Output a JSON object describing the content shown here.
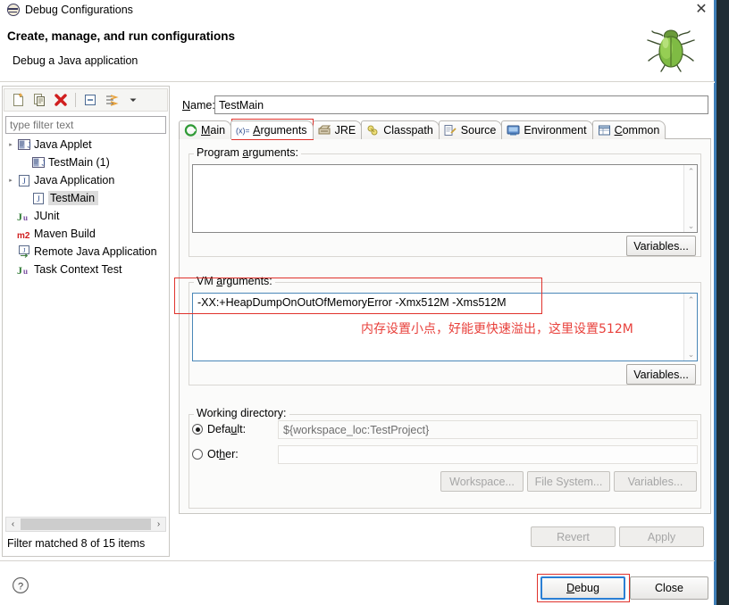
{
  "window": {
    "title": "Debug Configurations",
    "title_icon": "debug-config-icon",
    "close_label": "✕",
    "header_title": "Create, manage, and run configurations",
    "header_subtitle": "Debug a Java application",
    "decoration_icon": "green-bug-icon"
  },
  "sidebar": {
    "toolbar": [
      {
        "name": "new-configuration",
        "icon": "new-document-icon"
      },
      {
        "name": "duplicate-configuration",
        "icon": "copy-icon"
      },
      {
        "name": "delete-configuration",
        "icon": "red-x-delete-icon"
      },
      {
        "name": "collapse-all",
        "icon": "collapse-all-icon"
      },
      {
        "name": "filter-configurations",
        "icon": "filter-sort-icon"
      },
      {
        "name": "view-menu",
        "icon": "chevron-down-icon"
      }
    ],
    "filter": {
      "placeholder": "type filter text",
      "value": ""
    },
    "tree": [
      {
        "label": "Java Applet",
        "icon": "java-applet-icon",
        "indent": 0,
        "expandable": true,
        "selected": false
      },
      {
        "label": "TestMain (1)",
        "icon": "java-applet-icon",
        "indent": 1,
        "expandable": false,
        "selected": false
      },
      {
        "label": "Java Application",
        "icon": "java-application-icon",
        "indent": 0,
        "expandable": true,
        "selected": false
      },
      {
        "label": "TestMain",
        "icon": "java-application-icon",
        "indent": 1,
        "expandable": false,
        "selected": true
      },
      {
        "label": "JUnit",
        "icon": "junit-icon",
        "indent": 0,
        "expandable": false,
        "selected": false
      },
      {
        "label": "Maven Build",
        "icon": "maven-m2-icon",
        "indent": 0,
        "expandable": false,
        "selected": false
      },
      {
        "label": "Remote Java Application",
        "icon": "remote-java-application-icon",
        "indent": 0,
        "expandable": false,
        "selected": false
      },
      {
        "label": "Task Context Test",
        "icon": "junit-icon",
        "indent": 0,
        "expandable": false,
        "selected": false
      }
    ],
    "scrollbar": {
      "left_arrow": "‹",
      "right_arrow": "›"
    },
    "status": "Filter matched 8 of 15 items"
  },
  "config": {
    "name_label": "Name:",
    "name_label_underline": "N",
    "name_value": "TestMain",
    "tabs": [
      {
        "label": "Main",
        "icon": "main-green-circle-icon",
        "active": false,
        "underline": "M"
      },
      {
        "label": "Arguments",
        "icon": "arguments-x-icon",
        "active": true,
        "underline": "A",
        "highlighted": true
      },
      {
        "label": "JRE",
        "icon": "jre-icon",
        "active": false,
        "underline": ""
      },
      {
        "label": "Classpath",
        "icon": "classpath-icon",
        "active": false,
        "underline": ""
      },
      {
        "label": "Source",
        "icon": "source-icon",
        "active": false,
        "underline": ""
      },
      {
        "label": "Environment",
        "icon": "environment-icon",
        "active": false,
        "underline": ""
      },
      {
        "label": "Common",
        "icon": "common-icon",
        "active": false,
        "underline": "C"
      }
    ],
    "program_arguments": {
      "label": "Program arguments:",
      "label_underline": "a",
      "value": "",
      "variables_button": "Variables...",
      "scroll_up": "⌃",
      "scroll_down": "⌄"
    },
    "vm_arguments": {
      "label": "VM arguments:",
      "label_underline": "a",
      "value": "-XX:+HeapDumpOnOutOfMemoryError -Xmx512M -Xms512M",
      "variables_button": "Variables...",
      "annotation": "内存设置小点，好能更快速溢出，这里设置512M",
      "scroll_up": "⌃",
      "scroll_down": "⌄"
    },
    "working_directory": {
      "label": "Working directory:",
      "default_label": "Default:",
      "default_underline": "u",
      "default_selected": true,
      "default_value": "${workspace_loc:TestProject}",
      "other_label": "Other:",
      "other_underline": "h",
      "other_selected": false,
      "other_value": "",
      "workspace_button": "Workspace...",
      "file_system_button": "File System...",
      "variables_button": "Variables..."
    },
    "revert_button": "Revert",
    "apply_button": "Apply"
  },
  "footer": {
    "help_icon": "help-question-icon",
    "debug_button": "Debug",
    "debug_underline": "D",
    "close_button": "Close"
  },
  "colors": {
    "annotation_red": "#e8413c",
    "highlight_box_red": "#e0322c",
    "focus_blue": "#2a7fd4",
    "panel_bg": "#fbfbfa",
    "selection_gray": "#dcdcdc"
  }
}
